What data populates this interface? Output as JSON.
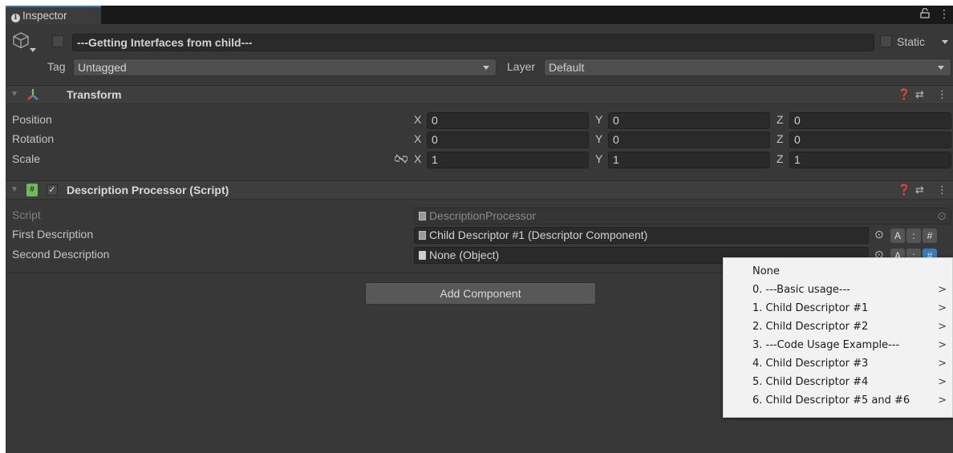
{
  "tab": {
    "label": "Inspector",
    "icon": "info-icon"
  },
  "gameobject": {
    "name": "---Getting Interfaces from child---",
    "static_label": "Static",
    "tag_label": "Tag",
    "tag_value": "Untagged",
    "layer_label": "Layer",
    "layer_value": "Default"
  },
  "transform": {
    "title": "Transform",
    "rows": [
      {
        "label": "Position",
        "x": "0",
        "y": "0",
        "z": "0"
      },
      {
        "label": "Rotation",
        "x": "0",
        "y": "0",
        "z": "0"
      },
      {
        "label": "Scale",
        "x": "1",
        "y": "1",
        "z": "1"
      }
    ],
    "axes": {
      "x": "X",
      "y": "Y",
      "z": "Z"
    }
  },
  "script_component": {
    "title": "Description Processor (Script)",
    "script_label": "Script",
    "script_value": "DescriptionProcessor",
    "first_label": "First Description",
    "first_value": "Child Descriptor #1 (Descriptor Component)",
    "second_label": "Second Description",
    "second_value": "None (Object)",
    "btn_a": "A",
    "btn_colon": ":",
    "btn_hash": "#"
  },
  "add_component": "Add Component",
  "popup": {
    "items": [
      {
        "label": "None",
        "submenu": false
      },
      {
        "label": "0. ---Basic usage---",
        "submenu": true
      },
      {
        "label": "1. Child Descriptor #1",
        "submenu": true
      },
      {
        "label": "2. Child Descriptor #2",
        "submenu": true
      },
      {
        "label": "3. ---Code Usage Example---",
        "submenu": true
      },
      {
        "label": "4. Child Descriptor #3",
        "submenu": true
      },
      {
        "label": "5. Child Descriptor #4",
        "submenu": true
      },
      {
        "label": "6. Child Descriptor #5 and #6",
        "submenu": true
      }
    ],
    "arrow": ">"
  },
  "colors": {
    "panel": "#383838",
    "accent": "#3a79bb",
    "popup_bg": "#f2f2f2"
  }
}
